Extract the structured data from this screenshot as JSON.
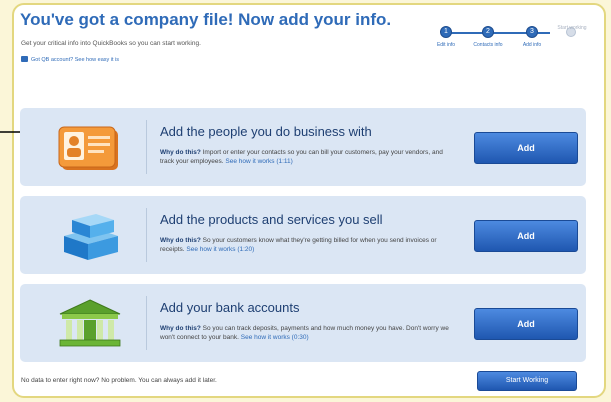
{
  "header": {
    "title": "You've got a company file! Now add your info.",
    "subtitle": "Get your critical info into QuickBooks so you can start working.",
    "help_link": "Got QB account? See how easy it is"
  },
  "progress": {
    "steps": [
      {
        "label": "Edit info"
      },
      {
        "label": "Contacts info"
      },
      {
        "label": "Add info"
      },
      {
        "label": "Start working"
      }
    ]
  },
  "cards": [
    {
      "heading": "Add the people you do business with",
      "why_label": "Why do this?",
      "why_text": "Import or enter your contacts so you can bill your customers, pay your vendors, and track your employees.",
      "more_link": "See how it works (1:11)",
      "button": "Add"
    },
    {
      "heading": "Add the products and services you sell",
      "why_label": "Why do this?",
      "why_text": "So your customers know what they're getting billed for when you send invoices or receipts.",
      "more_link": "See how it works (1:20)",
      "button": "Add"
    },
    {
      "heading": "Add your bank accounts",
      "why_label": "Why do this?",
      "why_text": "So you can track deposits, payments and how much money you have. Don't worry we won't connect to your bank.",
      "more_link": "See how it works (0:30)",
      "button": "Add"
    }
  ],
  "footer": {
    "text": "No data to enter right now? No problem. You can always add it later.",
    "start_button": "Start Working"
  },
  "colors": {
    "accent": "#2f6bb8",
    "card_bg": "#dbe6f4",
    "button": "#2a66c4",
    "frame_border": "#e3d77f"
  }
}
